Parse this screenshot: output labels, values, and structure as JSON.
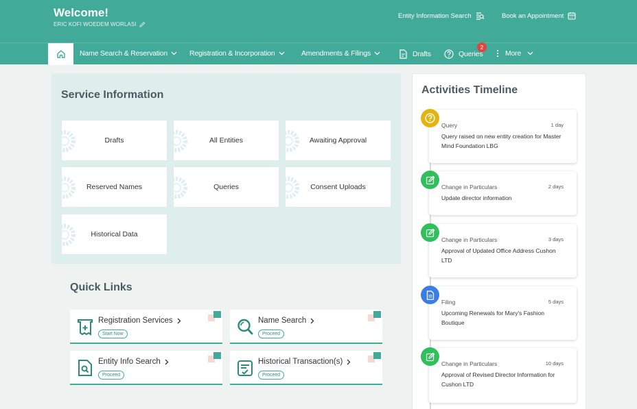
{
  "header": {
    "welcome": "Welcome!",
    "username": "ERIC KOFI WOEDEM WORLASI",
    "entity_search": "Entity Information Search",
    "book_appointment": "Book an Appointment"
  },
  "nav": {
    "items": [
      {
        "label": "Name Search & Reservation"
      },
      {
        "label": "Registration & Incorporation"
      },
      {
        "label": "Amendments & Filings"
      },
      {
        "label": "Drafts"
      },
      {
        "label": "Queries"
      },
      {
        "label": "More"
      }
    ],
    "queries_badge": "2"
  },
  "service": {
    "title": "Service Information",
    "cards": [
      "Drafts",
      "All Entities",
      "Awaiting Approval",
      "Reserved Names",
      "Queries",
      "Consent Uploads",
      "Historical Data"
    ]
  },
  "quick_links": {
    "title": "Quick Links",
    "items": [
      {
        "title": "Registration Services",
        "action": "Start Now"
      },
      {
        "title": "Name Search",
        "action": "Proceed"
      },
      {
        "title": "Entity Info Search",
        "action": "Proceed"
      },
      {
        "title": "Historical Transaction(s)",
        "action": "Proceed"
      }
    ]
  },
  "timeline": {
    "title": "Activities Timeline",
    "events": [
      {
        "type": "Query",
        "when": "1 day",
        "desc": "Query raised on new entity creation for Master Mind Foundation LBG",
        "color": "#e3b30f",
        "icon": "question-icon"
      },
      {
        "type": "Change in Particulars",
        "when": "2 days",
        "desc": "Update director information",
        "color": "#2fbf5b",
        "icon": "edit-icon"
      },
      {
        "type": "Change in Particulars",
        "when": "3 days",
        "desc": "Approval of Updated Office Address Cushon LTD",
        "color": "#2fbf5b",
        "icon": "edit-icon"
      },
      {
        "type": "Filing",
        "when": "5 days",
        "desc": "Upcoming Renewals for Mary's Fashion Boutique",
        "color": "#3b7de6",
        "icon": "document-icon"
      },
      {
        "type": "Change in Particulars",
        "when": "10 days",
        "desc": "Approval of Revised Director Information for Cushon LTD",
        "color": "#2fbf5b",
        "icon": "edit-icon"
      }
    ]
  }
}
